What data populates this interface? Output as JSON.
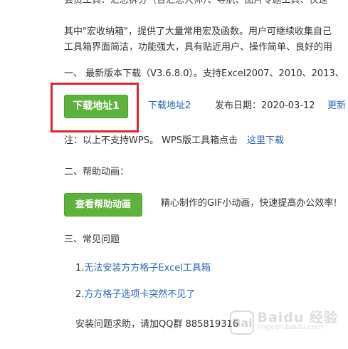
{
  "lines": {
    "top_partial": "会员工具：汇总拆分（合汇总大师）、导航、图片专题工具、快速",
    "intro1": "其中\"宏收纳箱\"，提供了大量常用宏及函数。用户可继续收集自己",
    "intro2": "工具箱界面简洁，功能强大，具有贴近用户、操作简单、良好的用"
  },
  "section1": {
    "heading": "一、 最新版本下载（V3.6.8.0）。支持Excel2007、2010、2013、",
    "download_btn": "下载地址1",
    "download2_link": "下载地址2",
    "release_label": "发布日期：2020-03-12",
    "update_link": "更新",
    "note_text": "注：以上不支持WPS。 WPS版工具箱点击",
    "note_link": "这里下载"
  },
  "section2": {
    "heading": "二、帮助动画：",
    "help_btn": "查看帮助动画",
    "help_desc": "精心制作的GIF小动画，快速提高办公效率!"
  },
  "section3": {
    "heading": "三、常见问题",
    "item1_num": "1.",
    "item1_link": "无法安装方方格子Excel工具箱",
    "item2_num": "2.",
    "item2_link": "方方格子选项卡突然不见了",
    "help_qq": "安装问题求助，请加QQ群 885819316"
  },
  "watermark": {
    "logo": "Bai",
    "main": "Baidu 经验",
    "sub": "jingyan.baidu.com"
  },
  "colors": {
    "link": "#2d64b3",
    "button": "#5cb23a",
    "highlight": "#e0242f"
  }
}
